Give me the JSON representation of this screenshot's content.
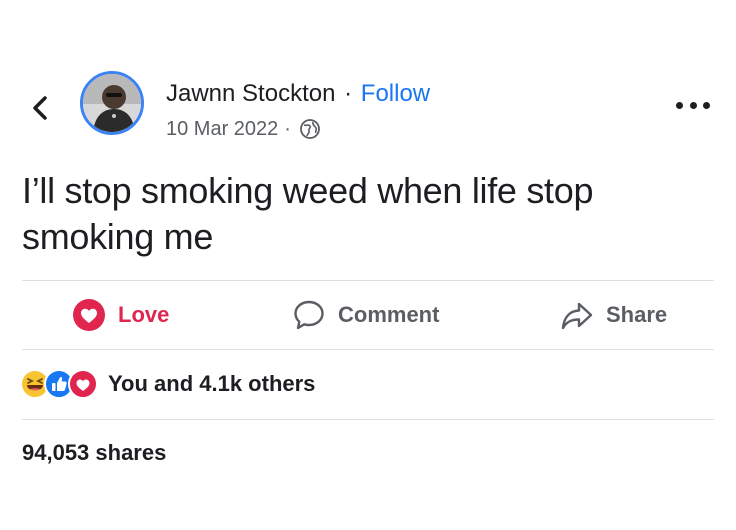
{
  "header": {
    "author_name": "Jawnn Stockton",
    "separator": "·",
    "follow_label": "Follow",
    "date": "10 Mar 2022",
    "meta_separator": "·",
    "privacy_icon": "globe-icon",
    "back_icon": "chevron-left-icon",
    "more_icon": "more-options-icon"
  },
  "post": {
    "text": "I’ll stop smoking weed when life stop smoking me"
  },
  "actions": {
    "love": {
      "label": "Love",
      "icon": "heart-icon",
      "color": "#e0264f"
    },
    "comment": {
      "label": "Comment",
      "icon": "comment-icon"
    },
    "share": {
      "label": "Share",
      "icon": "share-arrow-icon"
    }
  },
  "reactions": {
    "summary": "You and 4.1k others",
    "icons": [
      "haha-icon",
      "like-icon",
      "love-icon"
    ]
  },
  "stats": {
    "shares": "94,053 shares"
  },
  "colors": {
    "accent": "#1877f2",
    "love": "#e0264f",
    "muted": "#5a5e63",
    "avatar_ring": "#3b82f6"
  }
}
